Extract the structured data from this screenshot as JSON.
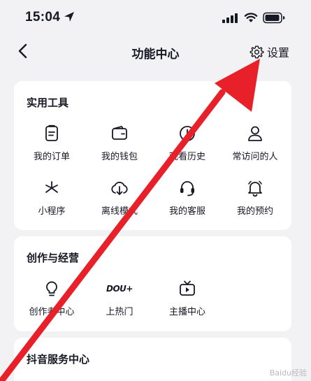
{
  "status_bar": {
    "time": "15:04"
  },
  "nav": {
    "title": "功能中心",
    "settings_label": "设置"
  },
  "sections": [
    {
      "title": "实用工具",
      "items": [
        {
          "label": "我的订单",
          "icon": "order-icon"
        },
        {
          "label": "我的钱包",
          "icon": "wallet-icon"
        },
        {
          "label": "观看历史",
          "icon": "history-clock-icon"
        },
        {
          "label": "常访问的人",
          "icon": "person-icon"
        },
        {
          "label": "小程序",
          "icon": "mini-program-icon"
        },
        {
          "label": "离线模式",
          "icon": "offline-download-icon"
        },
        {
          "label": "我的客服",
          "icon": "headset-icon"
        },
        {
          "label": "我的预约",
          "icon": "bell-icon"
        }
      ]
    },
    {
      "title": "创作与经营",
      "items": [
        {
          "label": "创作者中心",
          "icon": "lightbulb-icon"
        },
        {
          "label": "上热门",
          "icon": "dou-plus-icon",
          "icon_text": "DOU+"
        },
        {
          "label": "主播中心",
          "icon": "tv-play-icon"
        }
      ]
    },
    {
      "title": "抖音服务中心",
      "items": []
    }
  ],
  "watermark": "Baidu经验",
  "colors": {
    "arrow": "#e8202a",
    "background": "#f2f2f4",
    "card": "#ffffff",
    "text": "#161823"
  }
}
